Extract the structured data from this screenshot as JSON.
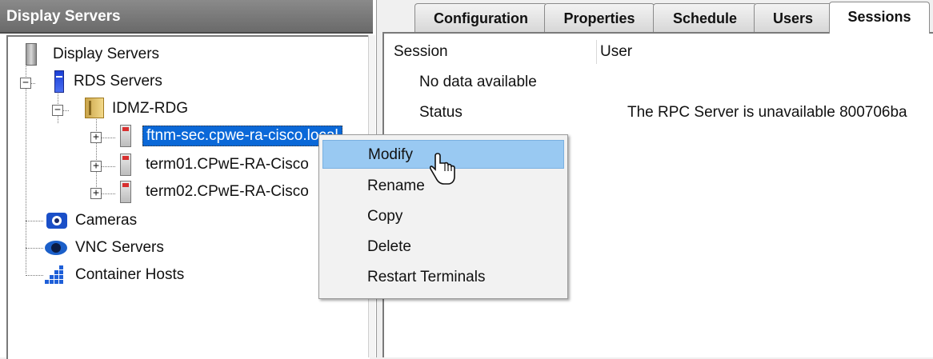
{
  "left_panel": {
    "header_title": "Display Servers",
    "tree": {
      "root_label": "Display Servers",
      "rds_label": "RDS Servers",
      "rdg_label": "IDMZ-RDG",
      "servers": [
        {
          "label": "ftnm-sec.cpwe-ra-cisco.local"
        },
        {
          "label": "term01.CPwE-RA-Cisco"
        },
        {
          "label": "term02.CPwE-RA-Cisco"
        }
      ],
      "cameras_label": "Cameras",
      "vnc_label": "VNC Servers",
      "container_label": "Container Hosts"
    }
  },
  "right_panel": {
    "tabs": [
      {
        "label": "Configuration"
      },
      {
        "label": "Properties"
      },
      {
        "label": "Schedule"
      },
      {
        "label": "Users"
      },
      {
        "label": "Sessions"
      }
    ],
    "active_tab": "Sessions",
    "columns": {
      "session": "Session",
      "user": "User"
    },
    "no_data_text": "No data available",
    "status_label": "Status",
    "status_value": "The RPC Server is unavailable 800706ba"
  },
  "context_menu": {
    "items": [
      {
        "label": "Modify"
      },
      {
        "label": "Rename"
      },
      {
        "label": "Copy"
      },
      {
        "label": "Delete"
      },
      {
        "label": "Restart Terminals"
      }
    ],
    "highlighted": "Modify"
  },
  "colors": {
    "selection": "#0a68d8",
    "menu_highlight": "#99c9f2",
    "header_gray": "#7a7a7a"
  }
}
